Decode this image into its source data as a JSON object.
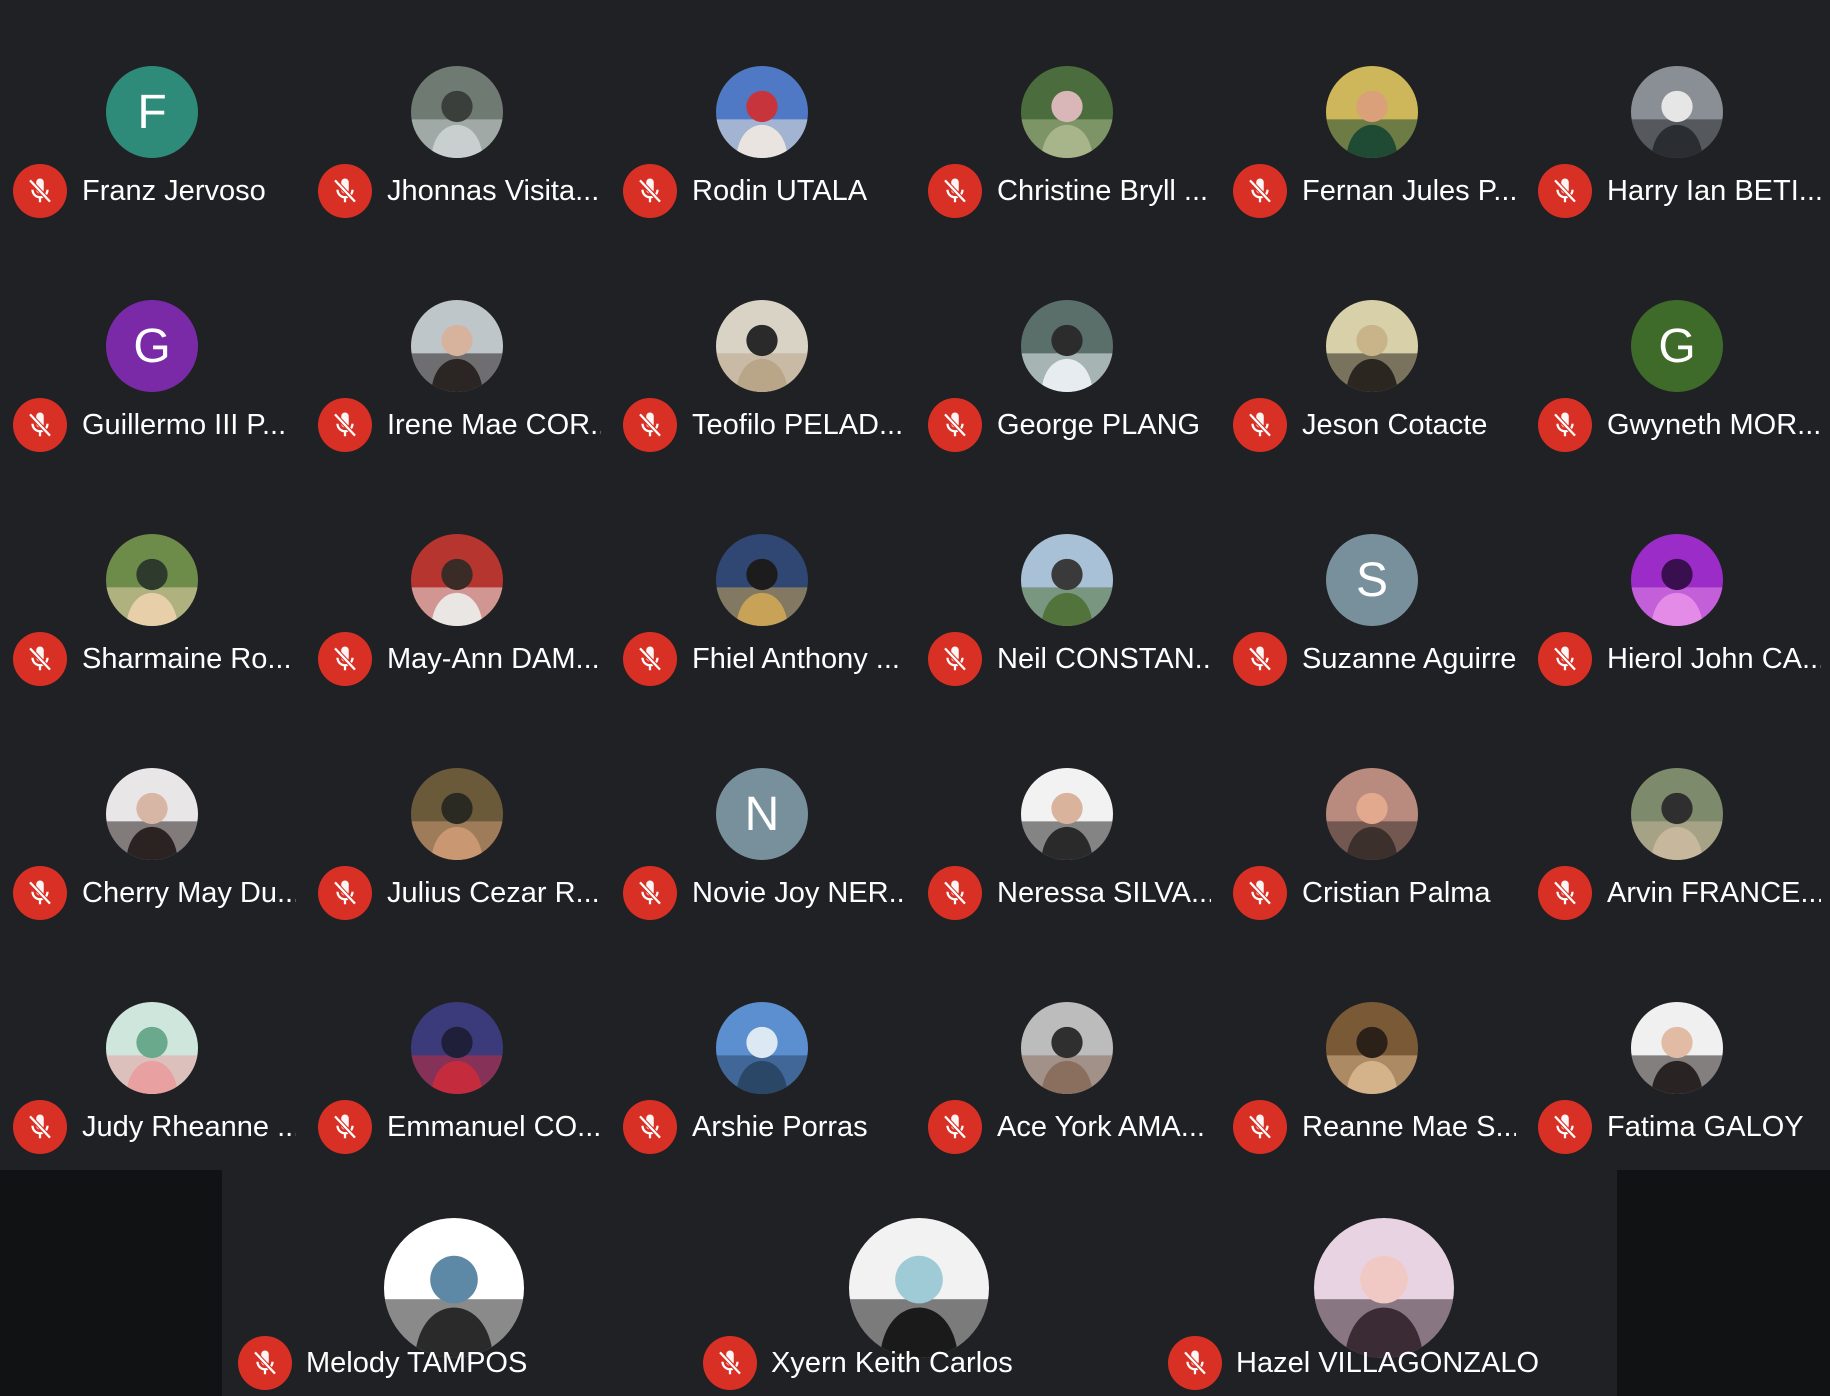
{
  "colors": {
    "background": "#202124",
    "strip_background": "#111213",
    "mic_off": "#d93025",
    "text": "#ffffff"
  },
  "participants": [
    {
      "name": "Franz Jervoso",
      "initial": "F",
      "avatar_color": "#2e8b7a",
      "avatar": "initial",
      "muted": true
    },
    {
      "name": "Jhonnas Visita...",
      "avatar": "photo",
      "photo_tones": [
        "#6f7a72",
        "#c9cfcf",
        "#3a3f3b"
      ],
      "muted": true
    },
    {
      "name": "Rodin UTALA",
      "avatar": "photo",
      "photo_tones": [
        "#4f79c4",
        "#e9e4df",
        "#c7343b"
      ],
      "muted": true
    },
    {
      "name": "Christine Bryll ...",
      "avatar": "photo",
      "photo_tones": [
        "#4b6d3d",
        "#a8b489",
        "#d9b7b9"
      ],
      "muted": true
    },
    {
      "name": "Fernan Jules P...",
      "avatar": "photo",
      "photo_tones": [
        "#cdb75a",
        "#1f4a34",
        "#d9a07a"
      ],
      "muted": true
    },
    {
      "name": "Harry Ian BETI...",
      "avatar": "photo",
      "photo_tones": [
        "#8a8f96",
        "#2a2d31",
        "#e6e6e6"
      ],
      "muted": true
    },
    {
      "name": "Guillermo III P...",
      "initial": "G",
      "avatar_color": "#7b2aa7",
      "avatar": "initial",
      "muted": true
    },
    {
      "name": "Irene Mae COR...",
      "avatar": "photo",
      "photo_tones": [
        "#bfc6c9",
        "#2b2524",
        "#d7b29d"
      ],
      "muted": true
    },
    {
      "name": "Teofilo PELAD...",
      "avatar": "photo",
      "photo_tones": [
        "#d9d3c5",
        "#b9a688",
        "#2a2a2a"
      ],
      "muted": true
    },
    {
      "name": "George PLANG",
      "avatar": "photo",
      "photo_tones": [
        "#5a6f6a",
        "#e6ecef",
        "#2c2c2c"
      ],
      "muted": true
    },
    {
      "name": "Jeson Cotacte",
      "avatar": "photo",
      "photo_tones": [
        "#d8d0a8",
        "#2c2620",
        "#c9b48a"
      ],
      "muted": true
    },
    {
      "name": "Gwyneth MOR...",
      "initial": "G",
      "avatar_color": "#3f6b2a",
      "avatar": "initial",
      "muted": true
    },
    {
      "name": "Sharmaine Ro...",
      "avatar": "photo",
      "photo_tones": [
        "#6d8c4a",
        "#e6cfa9",
        "#2e3a2c"
      ],
      "muted": true
    },
    {
      "name": "May-Ann DAM...",
      "avatar": "photo",
      "photo_tones": [
        "#b7352f",
        "#e9e6e4",
        "#3b2b27"
      ],
      "muted": true
    },
    {
      "name": "Fhiel Anthony ...",
      "avatar": "photo",
      "photo_tones": [
        "#2f4772",
        "#c8a257",
        "#1c1c1c"
      ],
      "muted": true
    },
    {
      "name": "Neil CONSTAN...",
      "avatar": "photo",
      "photo_tones": [
        "#a9c1d6",
        "#52733c",
        "#3a3a3a"
      ],
      "muted": true
    },
    {
      "name": "Suzanne Aguirre",
      "initial": "S",
      "avatar_color": "#78909c",
      "avatar": "initial",
      "muted": true
    },
    {
      "name": "Hierol John CA...",
      "avatar": "photo",
      "photo_tones": [
        "#9b2cc7",
        "#e48be7",
        "#3a0f4f"
      ],
      "muted": true
    },
    {
      "name": "Cherry May Du...",
      "avatar": "photo",
      "photo_tones": [
        "#e8e6e6",
        "#2b2222",
        "#d8b6a5"
      ],
      "muted": true
    },
    {
      "name": "Julius Cezar R...",
      "avatar": "photo",
      "photo_tones": [
        "#6a5a3a",
        "#c99872",
        "#2a2a22"
      ],
      "muted": true
    },
    {
      "name": "Novie Joy NER...",
      "initial": "N",
      "avatar_color": "#78909c",
      "avatar": "initial",
      "muted": true
    },
    {
      "name": "Neressa SILVA...",
      "avatar": "photo",
      "photo_tones": [
        "#f2f2f2",
        "#2a2a2a",
        "#d9b39b"
      ],
      "muted": true
    },
    {
      "name": "Cristian Palma",
      "avatar": "photo",
      "photo_tones": [
        "#b98a7e",
        "#3b302b",
        "#e3a98f"
      ],
      "muted": true
    },
    {
      "name": "Arvin FRANCE...",
      "avatar": "photo",
      "photo_tones": [
        "#7d8a6c",
        "#c6b79d",
        "#2f2f2f"
      ],
      "muted": true
    },
    {
      "name": "Judy Rheanne ...",
      "avatar": "photo",
      "photo_tones": [
        "#cfe6dc",
        "#e8a0a0",
        "#6aa98c"
      ],
      "muted": true
    },
    {
      "name": "Emmanuel CO...",
      "avatar": "photo",
      "photo_tones": [
        "#3b3a7a",
        "#c42b3d",
        "#1f1f3a"
      ],
      "muted": true
    },
    {
      "name": "Arshie Porras",
      "avatar": "photo",
      "photo_tones": [
        "#5b8fd0",
        "#2a4768",
        "#dce8f2"
      ],
      "muted": true
    },
    {
      "name": "Ace York AMA...",
      "avatar": "photo",
      "photo_tones": [
        "#bcbcbc",
        "#8a6e5e",
        "#2f2f2f"
      ],
      "muted": true
    },
    {
      "name": "Reanne Mae S...",
      "avatar": "photo",
      "photo_tones": [
        "#7a5a36",
        "#d4b28a",
        "#2c2118"
      ],
      "muted": true
    },
    {
      "name": "Fatima GALOY",
      "avatar": "photo",
      "photo_tones": [
        "#f0f0f0",
        "#2a2323",
        "#e1bba4"
      ],
      "muted": true
    }
  ],
  "bottom_participants": [
    {
      "name": "Melody TAMPOS",
      "avatar": "photo",
      "photo_tones": [
        "#ffffff",
        "#2a2a2a",
        "#5d88a6"
      ],
      "muted": true
    },
    {
      "name": "Xyern Keith Carlos",
      "avatar": "photo",
      "photo_tones": [
        "#f2f2f2",
        "#1a1a1a",
        "#9ecbd6"
      ],
      "muted": true
    },
    {
      "name": "Hazel VILLAGONZALO",
      "avatar": "photo",
      "photo_tones": [
        "#e7d3e2",
        "#3a2b35",
        "#f0c9c5"
      ],
      "muted": true
    }
  ],
  "icons": {
    "mic": "mic-off-icon"
  }
}
